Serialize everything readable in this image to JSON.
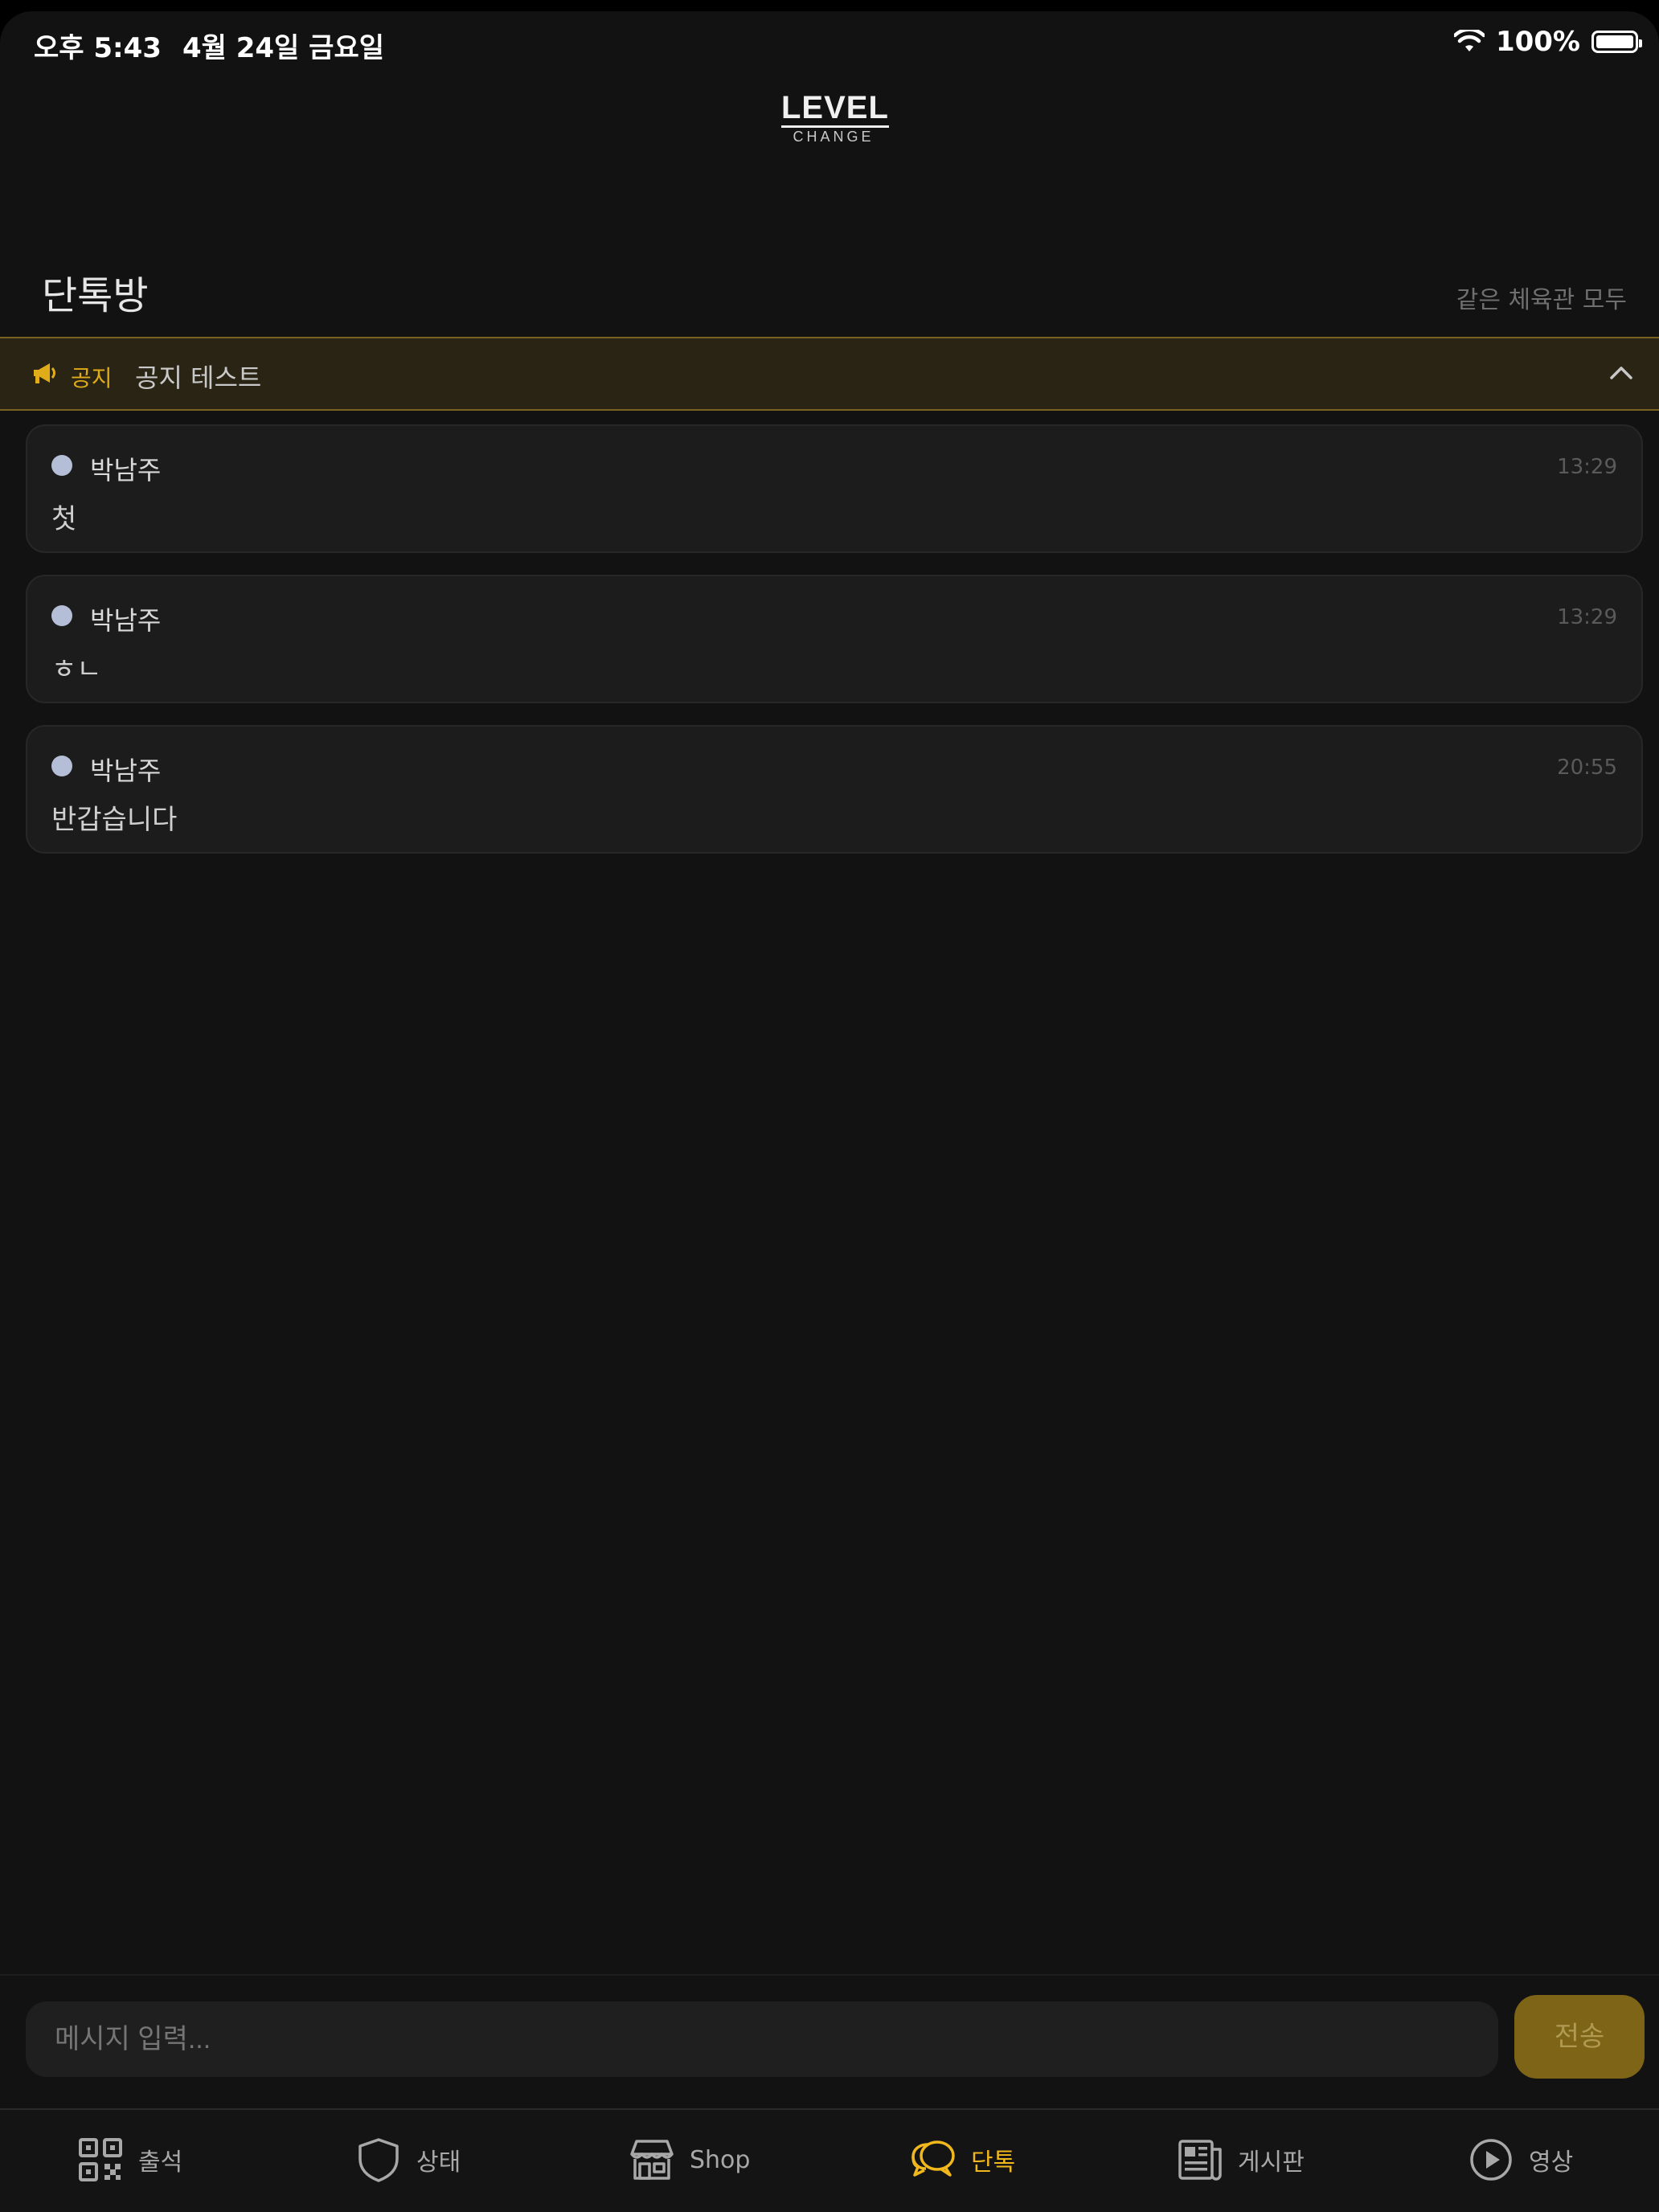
{
  "status_bar": {
    "time": "오후 5:43",
    "date": "4월 24일 금요일",
    "battery": "100%"
  },
  "logo": {
    "main": "LEVEL",
    "sub": "CHANGE"
  },
  "header": {
    "title": "단톡방",
    "subtitle": "같은 체육관 모두"
  },
  "notice": {
    "tag": "공지",
    "text": "공지 테스트"
  },
  "messages": [
    {
      "author": "박남주",
      "time": "13:29",
      "text": "첫"
    },
    {
      "author": "박남주",
      "time": "13:29",
      "text": "ㅎㄴ"
    },
    {
      "author": "박남주",
      "time": "20:55",
      "text": "반갑습니다"
    }
  ],
  "composer": {
    "placeholder": "메시지 입력...",
    "send_label": "전송"
  },
  "tabs": [
    {
      "label": "출석",
      "icon": "qr-code-icon"
    },
    {
      "label": "상태",
      "icon": "shield-icon"
    },
    {
      "label": "Shop",
      "icon": "store-icon"
    },
    {
      "label": "단톡",
      "icon": "chat-bubbles-icon",
      "active": true
    },
    {
      "label": "게시판",
      "icon": "newspaper-icon"
    },
    {
      "label": "영상",
      "icon": "play-circle-icon"
    }
  ],
  "colors": {
    "accent": "#f0b81c",
    "send_button": "#7d6416",
    "notice_bg": "#2a2414"
  }
}
